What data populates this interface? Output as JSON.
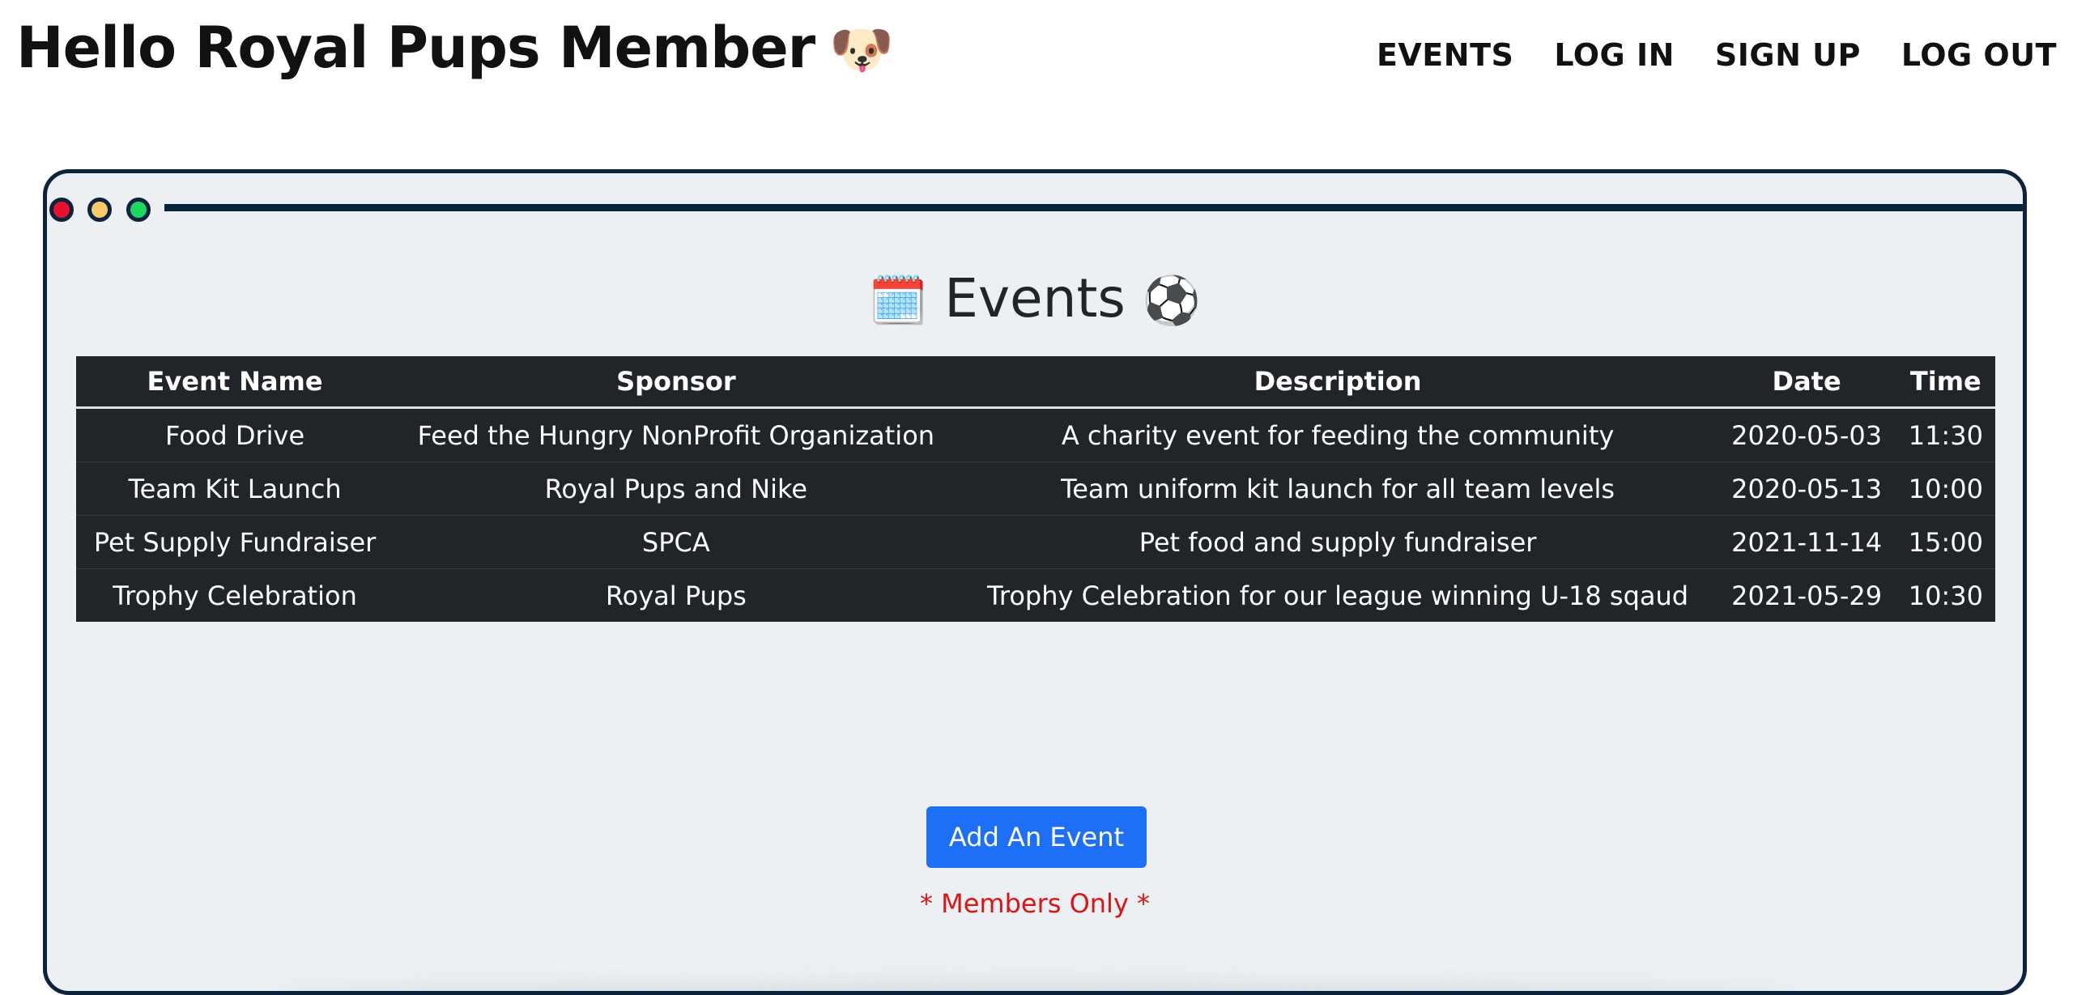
{
  "header": {
    "title": "Hello Royal Pups Member",
    "title_emoji": "🐶",
    "nav": [
      "EVENTS",
      "LOG IN",
      "SIGN UP",
      "LOG OUT"
    ]
  },
  "window": {
    "dots": [
      "red",
      "yellow",
      "green"
    ],
    "colors": {
      "frame": "#0c2340",
      "background": "#ecf0f3",
      "dot_red": "#e8112d",
      "dot_yellow": "#f7c96a",
      "dot_green": "#1ed760"
    }
  },
  "events": {
    "heading": "Events",
    "heading_icon_left": "🗓️",
    "heading_icon_right": "⚽",
    "columns": [
      "Event Name",
      "Sponsor",
      "Description",
      "Date",
      "Time"
    ],
    "rows": [
      [
        "Food Drive",
        "Feed the Hungry NonProfit Organization",
        "A charity event for feeding the community",
        "2020-05-03",
        "11:30"
      ],
      [
        "Team Kit Launch",
        "Royal Pups and Nike",
        "Team uniform kit launch for all team levels",
        "2020-05-13",
        "10:00"
      ],
      [
        "Pet Supply Fundraiser",
        "SPCA",
        "Pet food and supply fundraiser",
        "2021-11-14",
        "15:00"
      ],
      [
        "Trophy Celebration",
        "Royal Pups",
        "Trophy Celebration for our league winning U-18 sqaud",
        "2021-05-29",
        "10:30"
      ]
    ]
  },
  "actions": {
    "add_event_label": "Add An Event",
    "members_only_note": "* Members Only *",
    "button_color": "#1d6ff5",
    "note_color": "#dc1414"
  }
}
